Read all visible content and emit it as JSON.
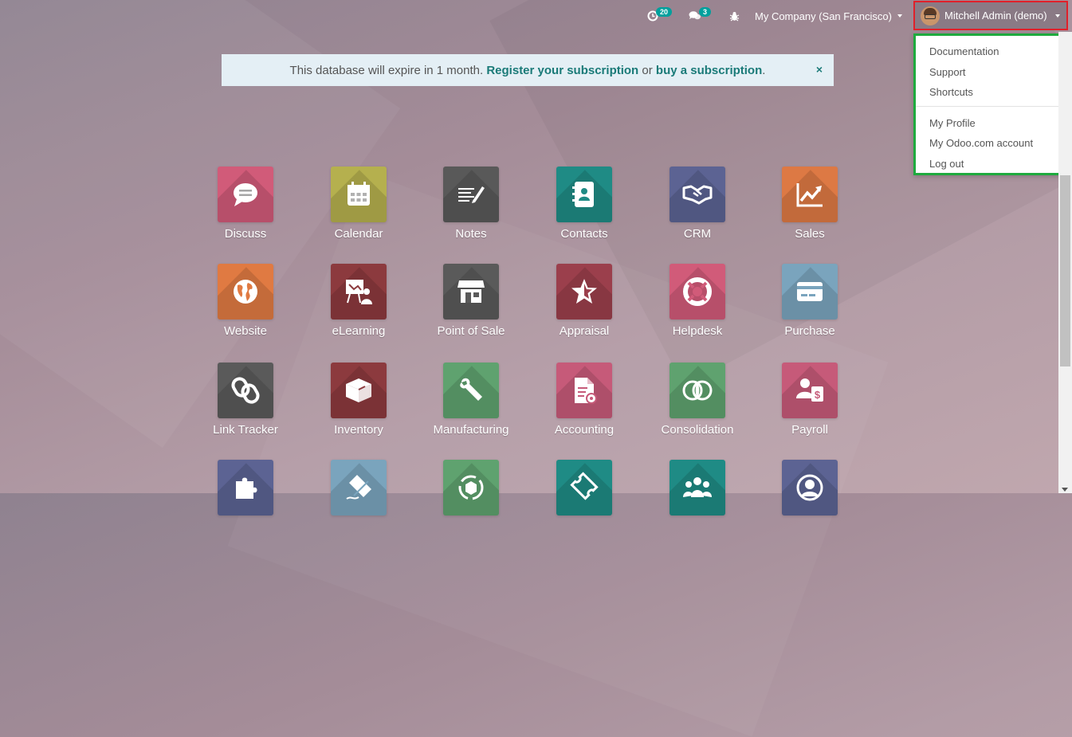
{
  "topbar": {
    "activity_count": "20",
    "messages_count": "3",
    "company": "My Company (San Francisco)",
    "user": "Mitchell Admin (demo)"
  },
  "user_menu": {
    "items": [
      "Documentation",
      "Support",
      "Shortcuts",
      "My Profile",
      "My Odoo.com account",
      "Log out"
    ]
  },
  "banner": {
    "text": "This database will expire in 1 month.",
    "register_link": "Register your subscription",
    "or": "or",
    "buy_link": "buy a subscription",
    "period": ".",
    "close": "×"
  },
  "apps": [
    {
      "label": "Discuss",
      "color": "#d15b79",
      "icon": "chat-icon"
    },
    {
      "label": "Calendar",
      "color": "#b5b04e",
      "icon": "calendar-icon"
    },
    {
      "label": "Notes",
      "color": "#595959",
      "icon": "notes-icon"
    },
    {
      "label": "Contacts",
      "color": "#1f8b85",
      "icon": "contacts-book-icon"
    },
    {
      "label": "CRM",
      "color": "#5c6393",
      "icon": "handshake-icon"
    },
    {
      "label": "Sales",
      "color": "#dd7944",
      "icon": "trend-chart-icon"
    },
    {
      "label": "Website",
      "color": "#e07a42",
      "icon": "globe-icon"
    },
    {
      "label": "eLearning",
      "color": "#8c3a3e",
      "icon": "presentation-icon"
    },
    {
      "label": "Point of Sale",
      "color": "#5a5a5a",
      "icon": "store-icon"
    },
    {
      "label": "Appraisal",
      "color": "#9b3f4c",
      "icon": "star-icon"
    },
    {
      "label": "Helpdesk",
      "color": "#d15b79",
      "icon": "lifebuoy-icon"
    },
    {
      "label": "Purchase",
      "color": "#7aa4bd",
      "icon": "credit-card-icon"
    },
    {
      "label": "Link Tracker",
      "color": "#5a5a5a",
      "icon": "link-icon"
    },
    {
      "label": "Inventory",
      "color": "#8c3a3e",
      "icon": "box-icon"
    },
    {
      "label": "Manufacturing",
      "color": "#5fa26f",
      "icon": "wrench-icon"
    },
    {
      "label": "Accounting",
      "color": "#c65a79",
      "icon": "document-gear-icon"
    },
    {
      "label": "Consolidation",
      "color": "#5fa26f",
      "icon": "overlap-circles-icon"
    },
    {
      "label": "Payroll",
      "color": "#c65a79",
      "icon": "payroll-icon"
    },
    {
      "label": "",
      "color": "#5c6393",
      "icon": "puzzle-icon"
    },
    {
      "label": "",
      "color": "#7aa4bd",
      "icon": "sign-pen-icon"
    },
    {
      "label": "",
      "color": "#5fa26f",
      "icon": "recycle-box-icon"
    },
    {
      "label": "",
      "color": "#1f8b85",
      "icon": "ticket-icon"
    },
    {
      "label": "",
      "color": "#1f8b85",
      "icon": "team-icon"
    },
    {
      "label": "",
      "color": "#5c6393",
      "icon": "user-circle-icon"
    }
  ]
}
